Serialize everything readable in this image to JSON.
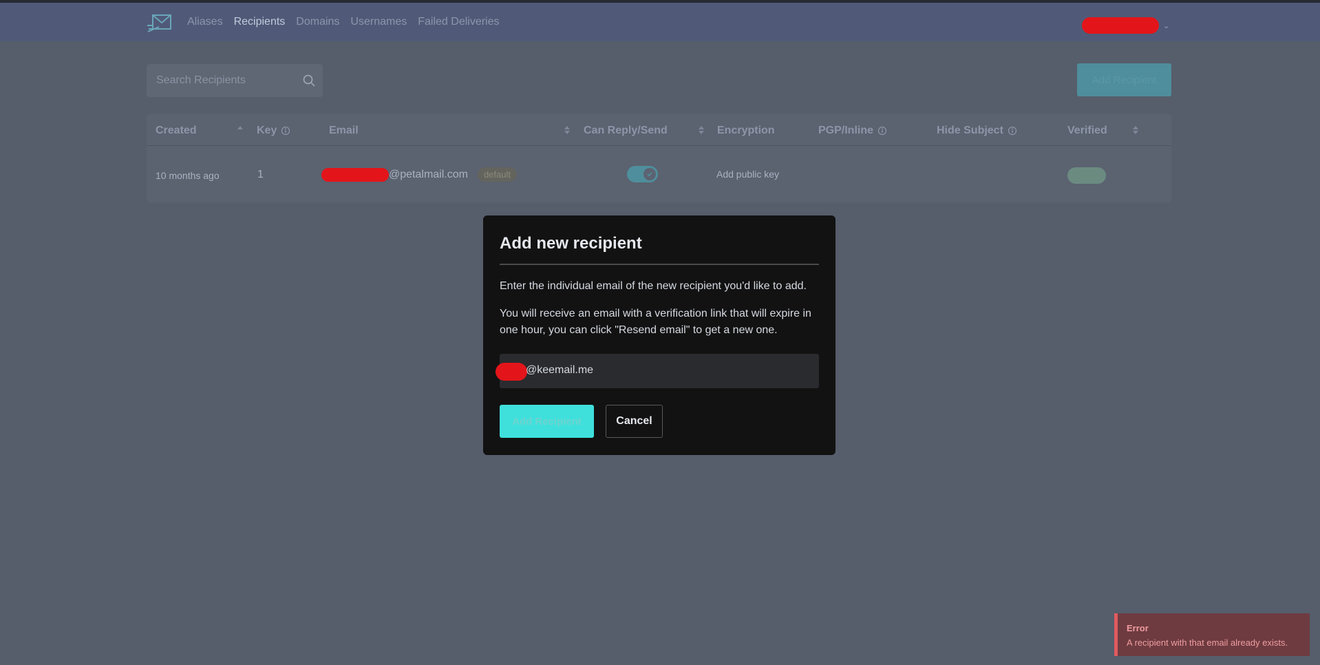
{
  "nav": {
    "logo": "envelope-logo",
    "links": [
      "Aliases",
      "Recipients",
      "Domains",
      "Usernames",
      "Failed Deliveries"
    ],
    "active": "Recipients"
  },
  "search": {
    "placeholder": "Search Recipients"
  },
  "toolbar": {
    "add_label": "Add Recipient"
  },
  "table": {
    "headers": {
      "created": "Created",
      "key": "Key",
      "email": "Email",
      "can_reply": "Can Reply/Send",
      "encryption": "Encryption",
      "pgp_inline": "PGP/Inline",
      "hide_subject": "Hide Subject",
      "verified": "Verified"
    },
    "rows": [
      {
        "created": "10 months ago",
        "key": "1",
        "email_domain": "@petalmail.com",
        "badge": "default",
        "can_reply": true,
        "encryption": "Add public key"
      }
    ]
  },
  "modal": {
    "title": "Add new recipient",
    "p1": "Enter the individual email of the new recipient you'd like to add.",
    "p2": "You will receive an email with a verification link that will expire in one hour, you can click \"Resend email\" to get a new one.",
    "input_value": "@keemail.me",
    "add_label": "Add Recipient",
    "cancel_label": "Cancel"
  },
  "toast": {
    "title": "Error",
    "message": "A recipient with that email already exists."
  },
  "colors": {
    "background": "#565d6b",
    "navbar": "#505a78",
    "accent": "#3fe0dc",
    "modal": "#121212",
    "error": "#e05b5e",
    "redaction": "#e3151a"
  }
}
